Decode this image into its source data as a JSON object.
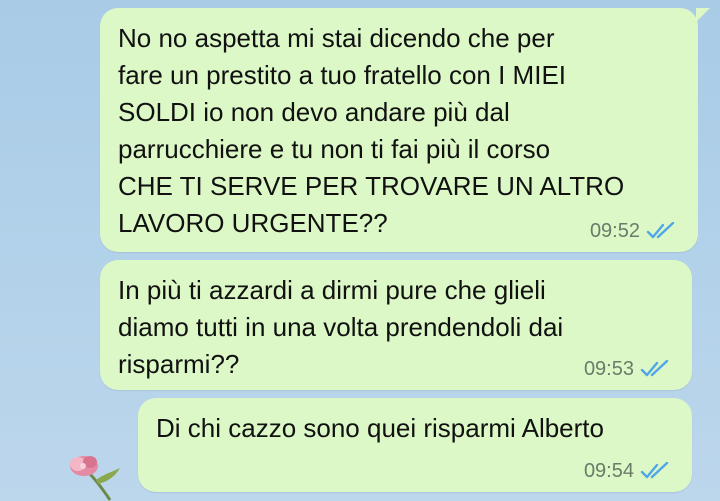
{
  "messages": [
    {
      "text": "No no aspetta  mi stai dicendo che per\nfare un prestito a tuo fratello con I MIEI\nSOLDI io non devo andare più dal\nparrucchiere e tu non ti fai più il corso\nCHE TI SERVE PER TROVARE UN ALTRO\nLAVORO URGENTE??",
      "time": "09:52",
      "status_icon": "double-check-read-icon"
    },
    {
      "text": "In più ti azzardi a dirmi pure che glieli\ndiamo tutti in una volta prendendoli dai\nrisparmi??",
      "time": "09:53",
      "status_icon": "double-check-read-icon"
    },
    {
      "text": "Di chi cazzo sono quei risparmi Alberto",
      "time": "09:54",
      "status_icon": "double-check-read-icon"
    }
  ],
  "colors": {
    "bubble_outgoing": "#dcf8c6",
    "wallpaper": "#b3d2ea",
    "read_ticks": "#4fa6e8",
    "timestamp": "#6b7b6b"
  }
}
